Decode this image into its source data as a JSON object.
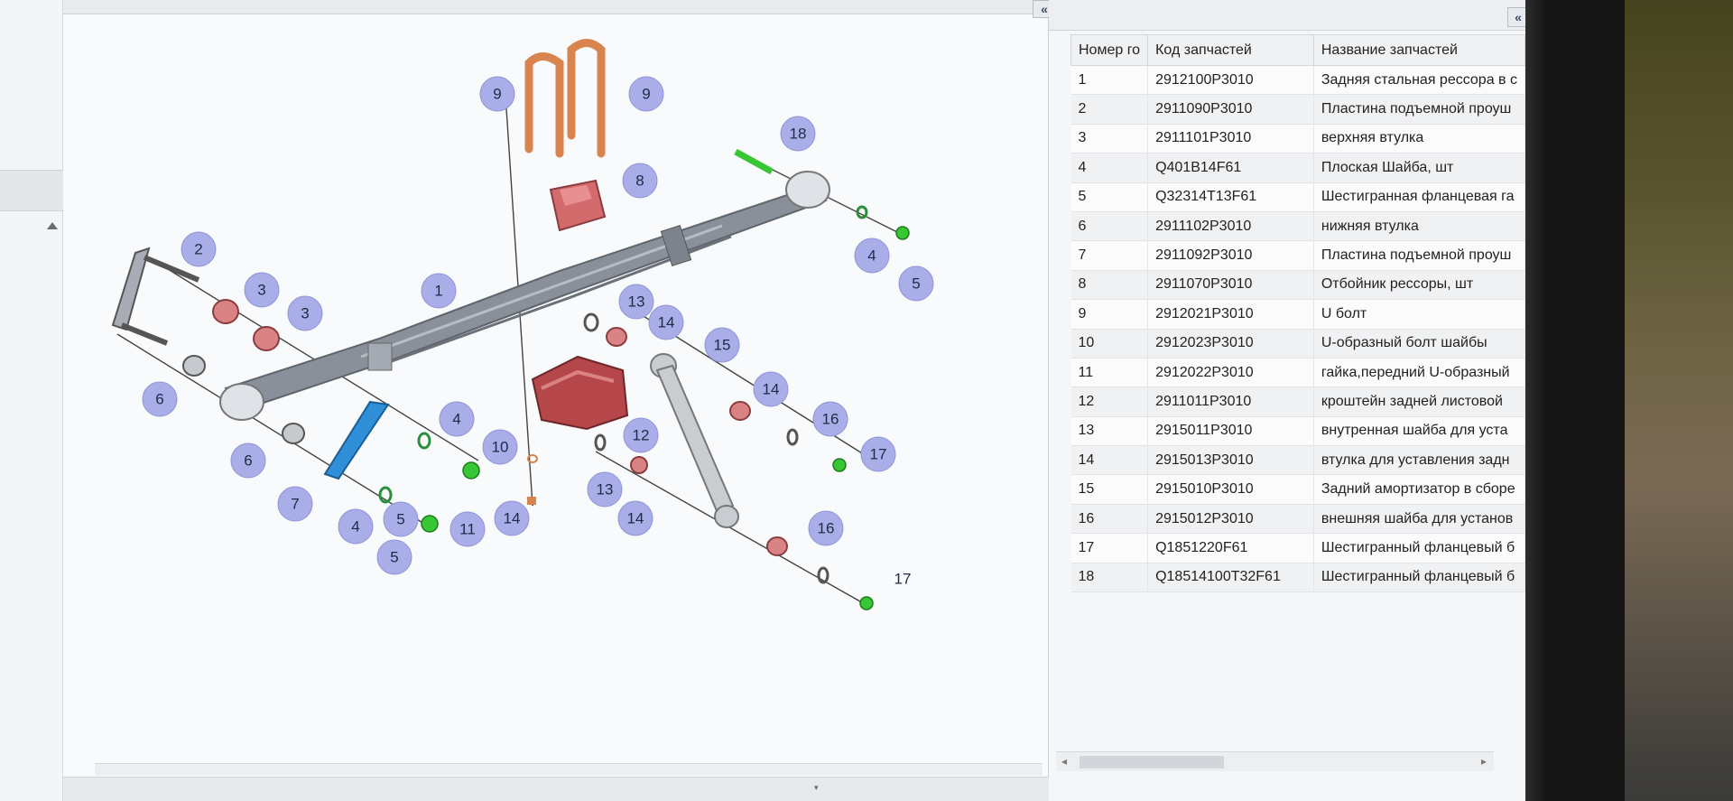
{
  "toolbar": {
    "collapse_diagram_label": "«",
    "collapse_table_label": "«"
  },
  "table": {
    "headers": [
      "Номер го",
      "Код запчастей",
      "Название запчастей"
    ],
    "rows": [
      {
        "num": "1",
        "code": "2912100P3010",
        "name": "Задняя стальная рессора в с"
      },
      {
        "num": "2",
        "code": "2911090P3010",
        "name": "Пластина подъемной проуш"
      },
      {
        "num": "3",
        "code": "2911101P3010",
        "name": "верхняя втулка"
      },
      {
        "num": "4",
        "code": "Q401B14F61",
        "name": "Плоская Шайба, шт"
      },
      {
        "num": "5",
        "code": "Q32314T13F61",
        "name": "Шестигранная фланцевая га"
      },
      {
        "num": "6",
        "code": "2911102P3010",
        "name": "нижняя втулка"
      },
      {
        "num": "7",
        "code": "2911092P3010",
        "name": "Пластина подъемной проуш"
      },
      {
        "num": "8",
        "code": "2911070P3010",
        "name": "Отбойник рессоры, шт"
      },
      {
        "num": "9",
        "code": "2912021P3010",
        "name": "U болт"
      },
      {
        "num": "10",
        "code": "2912023P3010",
        "name": "U-образный болт шайбы"
      },
      {
        "num": "11",
        "code": "2912022P3010",
        "name": "гайка,передний U-образный"
      },
      {
        "num": "12",
        "code": "2911011P3010",
        "name": "кроштейн задней листовой"
      },
      {
        "num": "13",
        "code": "2915011P3010",
        "name": "внутренная шайба для уста"
      },
      {
        "num": "14",
        "code": "2915013P3010",
        "name": "втулка для уставления задн"
      },
      {
        "num": "15",
        "code": "2915010P3010",
        "name": "Задний амортизатор в сборе"
      },
      {
        "num": "16",
        "code": "2915012P3010",
        "name": "внешняя шайба для установ"
      },
      {
        "num": "17",
        "code": "Q1851220F61",
        "name": "Шестигранный фланцевый б"
      },
      {
        "num": "18",
        "code": "Q18514100T32F61",
        "name": "Шестигранный фланцевый б"
      }
    ]
  },
  "diagram": {
    "callouts": [
      "9",
      "9",
      "18",
      "8",
      "2",
      "3",
      "3",
      "1",
      "4",
      "5",
      "13",
      "14",
      "15",
      "6",
      "14",
      "16",
      "17",
      "4",
      "10",
      "12",
      "6",
      "7",
      "13",
      "4",
      "5",
      "11",
      "14",
      "14",
      "16",
      "5",
      "17"
    ],
    "colors": {
      "leaf_spring": "#8a909a",
      "u_bolt": "#d9844e",
      "bracket": "#b5474a",
      "bushing": "#d98384",
      "nut_green": "#37c634",
      "plate_blue": "#2f8fd8",
      "shock": "#c9cdd2",
      "callout_fill": "#a9aee8"
    }
  },
  "scroll": {
    "left_arrow": "◂",
    "right_arrow": "▸"
  }
}
